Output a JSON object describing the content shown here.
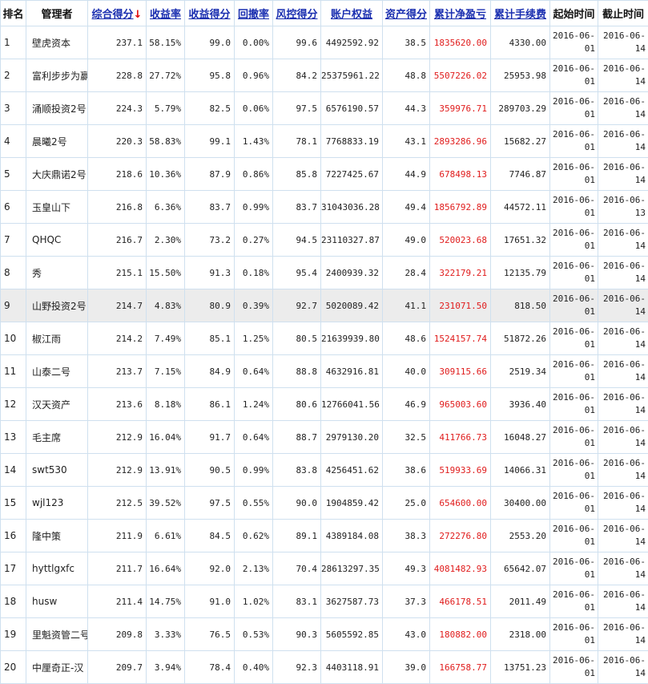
{
  "headers": {
    "rank": "排名",
    "manager": "管理者",
    "total_score": "综合得分",
    "sort_arrow": "↓",
    "return_rate": "收益率",
    "return_score": "收益得分",
    "drawdown": "回撤率",
    "risk_score": "风控得分",
    "equity": "账户权益",
    "asset_score": "资产得分",
    "net_profit": "累计净盈亏",
    "fees": "累计手续费",
    "start": "起始时间",
    "end": "截止时间"
  },
  "colors": {
    "link": "#1a2fb0",
    "profit": "#e01c1c",
    "border": "#cfe0ef",
    "highlight_row": "#ececec"
  },
  "rows": [
    {
      "rank": "1",
      "manager": "壁虎资本",
      "total": "237.1",
      "rr": "58.15%",
      "rs": "99.0",
      "dd": "0.00%",
      "risk": "99.6",
      "equity": "4492592.92",
      "asset": "38.5",
      "profit": "1835620.00",
      "fees": "4330.00",
      "start": "2016-06-01",
      "end": "2016-06-14"
    },
    {
      "rank": "2",
      "manager": "富利步步为赢",
      "total": "228.8",
      "rr": "27.72%",
      "rs": "95.8",
      "dd": "0.96%",
      "risk": "84.2",
      "equity": "25375961.22",
      "asset": "48.8",
      "profit": "5507226.02",
      "fees": "25953.98",
      "start": "2016-06-01",
      "end": "2016-06-14"
    },
    {
      "rank": "3",
      "manager": "涌顺投资2号",
      "total": "224.3",
      "rr": "5.79%",
      "rs": "82.5",
      "dd": "0.06%",
      "risk": "97.5",
      "equity": "6576190.57",
      "asset": "44.3",
      "profit": "359976.71",
      "fees": "289703.29",
      "start": "2016-06-01",
      "end": "2016-06-14"
    },
    {
      "rank": "4",
      "manager": "晨曦2号",
      "total": "220.3",
      "rr": "58.83%",
      "rs": "99.1",
      "dd": "1.43%",
      "risk": "78.1",
      "equity": "7768833.19",
      "asset": "43.1",
      "profit": "2893286.96",
      "fees": "15682.27",
      "start": "2016-06-01",
      "end": "2016-06-14"
    },
    {
      "rank": "5",
      "manager": "大庆鼎诺2号",
      "total": "218.6",
      "rr": "10.36%",
      "rs": "87.9",
      "dd": "0.86%",
      "risk": "85.8",
      "equity": "7227425.67",
      "asset": "44.9",
      "profit": "678498.13",
      "fees": "7746.87",
      "start": "2016-06-01",
      "end": "2016-06-14"
    },
    {
      "rank": "6",
      "manager": "玉皇山下",
      "total": "216.8",
      "rr": "6.36%",
      "rs": "83.7",
      "dd": "0.99%",
      "risk": "83.7",
      "equity": "31043036.28",
      "asset": "49.4",
      "profit": "1856792.89",
      "fees": "44572.11",
      "start": "2016-06-01",
      "end": "2016-06-13"
    },
    {
      "rank": "7",
      "manager": "QHQC",
      "total": "216.7",
      "rr": "2.30%",
      "rs": "73.2",
      "dd": "0.27%",
      "risk": "94.5",
      "equity": "23110327.87",
      "asset": "49.0",
      "profit": "520023.68",
      "fees": "17651.32",
      "start": "2016-06-01",
      "end": "2016-06-14"
    },
    {
      "rank": "8",
      "manager": "秀",
      "total": "215.1",
      "rr": "15.50%",
      "rs": "91.3",
      "dd": "0.18%",
      "risk": "95.4",
      "equity": "2400939.32",
      "asset": "28.4",
      "profit": "322179.21",
      "fees": "12135.79",
      "start": "2016-06-01",
      "end": "2016-06-14"
    },
    {
      "rank": "9",
      "manager": "山野投资2号",
      "total": "214.7",
      "rr": "4.83%",
      "rs": "80.9",
      "dd": "0.39%",
      "risk": "92.7",
      "equity": "5020089.42",
      "asset": "41.1",
      "profit": "231071.50",
      "fees": "818.50",
      "start": "2016-06-01",
      "end": "2016-06-14"
    },
    {
      "rank": "10",
      "manager": "椒江雨",
      "total": "214.2",
      "rr": "7.49%",
      "rs": "85.1",
      "dd": "1.25%",
      "risk": "80.5",
      "equity": "21639939.80",
      "asset": "48.6",
      "profit": "1524157.74",
      "fees": "51872.26",
      "start": "2016-06-01",
      "end": "2016-06-14"
    },
    {
      "rank": "11",
      "manager": "山泰二号",
      "total": "213.7",
      "rr": "7.15%",
      "rs": "84.9",
      "dd": "0.64%",
      "risk": "88.8",
      "equity": "4632916.81",
      "asset": "40.0",
      "profit": "309115.66",
      "fees": "2519.34",
      "start": "2016-06-01",
      "end": "2016-06-14"
    },
    {
      "rank": "12",
      "manager": "汉天资产",
      "total": "213.6",
      "rr": "8.18%",
      "rs": "86.1",
      "dd": "1.24%",
      "risk": "80.6",
      "equity": "12766041.56",
      "asset": "46.9",
      "profit": "965003.60",
      "fees": "3936.40",
      "start": "2016-06-01",
      "end": "2016-06-14"
    },
    {
      "rank": "13",
      "manager": "毛主席",
      "total": "212.9",
      "rr": "16.04%",
      "rs": "91.7",
      "dd": "0.64%",
      "risk": "88.7",
      "equity": "2979130.20",
      "asset": "32.5",
      "profit": "411766.73",
      "fees": "16048.27",
      "start": "2016-06-01",
      "end": "2016-06-14"
    },
    {
      "rank": "14",
      "manager": "swt530",
      "total": "212.9",
      "rr": "13.91%",
      "rs": "90.5",
      "dd": "0.99%",
      "risk": "83.8",
      "equity": "4256451.62",
      "asset": "38.6",
      "profit": "519933.69",
      "fees": "14066.31",
      "start": "2016-06-01",
      "end": "2016-06-14"
    },
    {
      "rank": "15",
      "manager": "wjl123",
      "total": "212.5",
      "rr": "39.52%",
      "rs": "97.5",
      "dd": "0.55%",
      "risk": "90.0",
      "equity": "1904859.42",
      "asset": "25.0",
      "profit": "654600.00",
      "fees": "30400.00",
      "start": "2016-06-01",
      "end": "2016-06-14"
    },
    {
      "rank": "16",
      "manager": "隆中策",
      "total": "211.9",
      "rr": "6.61%",
      "rs": "84.5",
      "dd": "0.62%",
      "risk": "89.1",
      "equity": "4389184.08",
      "asset": "38.3",
      "profit": "272276.80",
      "fees": "2553.20",
      "start": "2016-06-01",
      "end": "2016-06-14"
    },
    {
      "rank": "17",
      "manager": "hyttlgxfc",
      "total": "211.7",
      "rr": "16.64%",
      "rs": "92.0",
      "dd": "2.13%",
      "risk": "70.4",
      "equity": "28613297.35",
      "asset": "49.3",
      "profit": "4081482.93",
      "fees": "65642.07",
      "start": "2016-06-01",
      "end": "2016-06-14"
    },
    {
      "rank": "18",
      "manager": "husw",
      "total": "211.4",
      "rr": "14.75%",
      "rs": "91.0",
      "dd": "1.02%",
      "risk": "83.1",
      "equity": "3627587.73",
      "asset": "37.3",
      "profit": "466178.51",
      "fees": "2011.49",
      "start": "2016-06-01",
      "end": "2016-06-14"
    },
    {
      "rank": "19",
      "manager": "里魁资管二号",
      "total": "209.8",
      "rr": "3.33%",
      "rs": "76.5",
      "dd": "0.53%",
      "risk": "90.3",
      "equity": "5605592.85",
      "asset": "43.0",
      "profit": "180882.00",
      "fees": "2318.00",
      "start": "2016-06-01",
      "end": "2016-06-14"
    },
    {
      "rank": "20",
      "manager": "中厘奇正-汉",
      "total": "209.7",
      "rr": "3.94%",
      "rs": "78.4",
      "dd": "0.40%",
      "risk": "92.3",
      "equity": "4403118.91",
      "asset": "39.0",
      "profit": "166758.77",
      "fees": "13751.23",
      "start": "2016-06-01",
      "end": "2016-06-14"
    }
  ]
}
